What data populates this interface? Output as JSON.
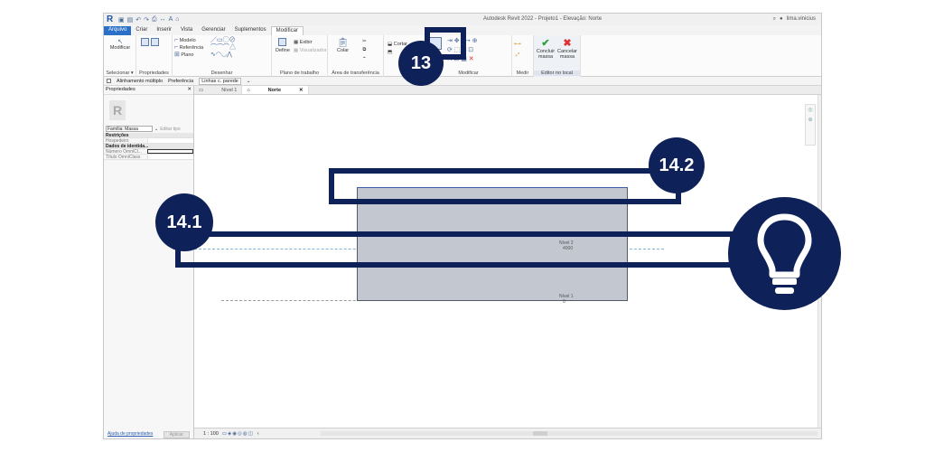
{
  "window": {
    "title": "Autodesk Revit 2022 - Projeto1 - Elevação: Norte",
    "user": "lima.vinicius",
    "app_logo": "R"
  },
  "ribbon_tabs": [
    "Arquivo",
    "Criar",
    "Inserir",
    "Vista",
    "Gerenciar",
    "Suplementos",
    "Modificar"
  ],
  "ribbon": {
    "selecionar": {
      "modify_label": "Modificar",
      "group_label": "Selecionar ▾"
    },
    "propriedades": {
      "group_label": "Propriedades"
    },
    "desenhar": {
      "items": [
        "Modelo",
        "Referência",
        "Plano"
      ],
      "group_label": "Desenhar"
    },
    "plano_trabalho": {
      "define": "Define",
      "exibir": "Exibir",
      "visualizador": "Visualizador",
      "group_label": "Plano de trabalho"
    },
    "transferencia": {
      "colar": "Colar",
      "group_label": "Área de transferência"
    },
    "geometria": {
      "cortar": "Cortar"
    },
    "modificar": {
      "group_label": "Modificar"
    },
    "medir": {
      "group_label": "Medir"
    },
    "editor": {
      "concluir": "Concluir massa",
      "cancelar": "Cancelar massa",
      "group_label": "Editor no local"
    }
  },
  "options_bar": {
    "multiple_align": "Alinhamento múltiplo",
    "preference_label": "Preferência",
    "preference_value": "Linhas c. parede"
  },
  "properties": {
    "title": "Propriedades",
    "family": "Família: Massa",
    "edit_type": "Editar tipo",
    "sections": [
      {
        "title": "Restrições",
        "rows": [
          {
            "key": "Hospedeiro",
            "value": ""
          }
        ]
      },
      {
        "title": "Dados de identida...",
        "rows": [
          {
            "key": "Número OmniCl...",
            "value": ""
          },
          {
            "key": "Título OmniClass",
            "value": ""
          }
        ]
      }
    ],
    "help_link": "Ajuda de propriedades",
    "apply": "Aplicar"
  },
  "view_tabs": [
    {
      "label": "Nível 1",
      "active": false
    },
    {
      "label": "Norte",
      "active": true
    }
  ],
  "levels": [
    {
      "name": "Nível 2",
      "value": "4000"
    },
    {
      "name": "Nível 1",
      "value": "0"
    }
  ],
  "status": {
    "scale": "1 : 100"
  },
  "annotations": {
    "step_13": "13",
    "step_14_1": "14.1",
    "step_14_2": "14.2",
    "tip_icon": "lightbulb-icon"
  },
  "colors": {
    "overlay": "#0f2159",
    "mass_fill": "#c3c8d0",
    "file_tab": "#2a70c8"
  }
}
